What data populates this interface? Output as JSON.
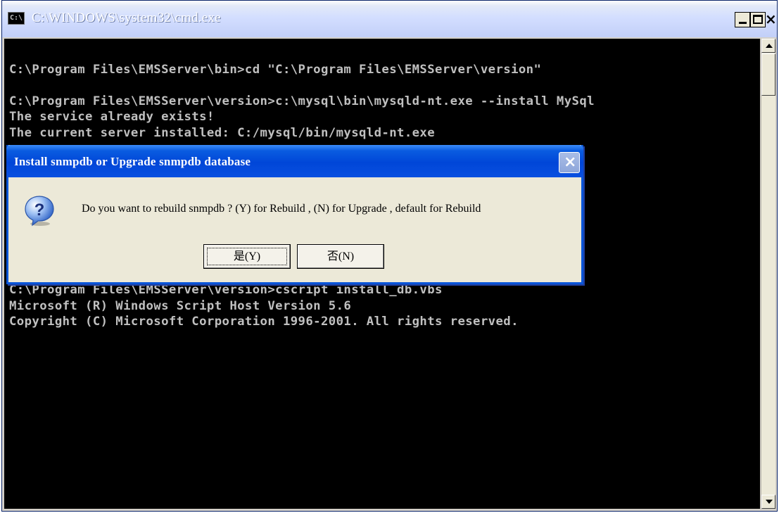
{
  "window": {
    "icon_label": "C:\\",
    "title": "C:\\WINDOWS\\system32\\cmd.exe",
    "minimize_label": "",
    "maximize_label": "",
    "close_label": "×"
  },
  "console": {
    "lines": [
      "",
      "C:\\Program Files\\EMSServer\\bin>cd \"C:\\Program Files\\EMSServer\\version\"",
      "",
      "C:\\Program Files\\EMSServer\\version>c:\\mysql\\bin\\mysqld-nt.exe --install MySql",
      "The service already exists!",
      "The current server installed: C:/mysql/bin/mysqld-nt.exe",
      "",
      "",
      "",
      "",
      "",
      "",
      "",
      "",
      "",
      "C:\\Program Files\\EMSServer\\version>cscript install_db.vbs",
      "Microsoft (R) Windows Script Host Version 5.6",
      "Copyright (C) Microsoft Corporation 1996-2001. All rights reserved."
    ]
  },
  "dialog": {
    "title": "Install snmpdb or Upgrade snmpdb database",
    "close_label": "×",
    "message": "Do you want to rebuild snmpdb ? (Y) for Rebuild , (N) for Upgrade , default for Rebuild",
    "yes_label": "是(Y)",
    "no_label": "否(N)",
    "icon": "question-icon"
  },
  "colors": {
    "console_bg": "#000000",
    "console_text": "#c0c0c0",
    "dialog_title_bg": "#0046d8",
    "dialog_bg": "#ece9d8"
  }
}
